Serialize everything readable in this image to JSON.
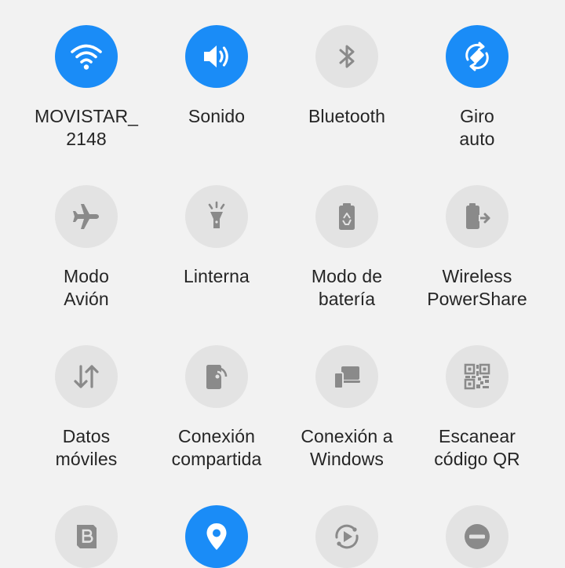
{
  "tiles": [
    {
      "label": "MOVISTAR_\n2148",
      "icon": "wifi-icon",
      "active": true
    },
    {
      "label": "Sonido",
      "icon": "sound-icon",
      "active": true
    },
    {
      "label": "Bluetooth",
      "icon": "bluetooth-icon",
      "active": false
    },
    {
      "label": "Giro\nauto",
      "icon": "auto-rotate-icon",
      "active": true
    },
    {
      "label": "Modo\nAvión",
      "icon": "airplane-icon",
      "active": false
    },
    {
      "label": "Linterna",
      "icon": "flashlight-icon",
      "active": false
    },
    {
      "label": "Modo de\nbatería",
      "icon": "battery-mode-icon",
      "active": false
    },
    {
      "label": "Wireless\nPowerShare",
      "icon": "wireless-powershare-icon",
      "active": false
    },
    {
      "label": "Datos\nmóviles",
      "icon": "mobile-data-icon",
      "active": false
    },
    {
      "label": "Conexión\ncompartida",
      "icon": "hotspot-icon",
      "active": false
    },
    {
      "label": "Conexión a\nWindows",
      "icon": "link-to-windows-icon",
      "active": false
    },
    {
      "label": "Escanear\ncódigo QR",
      "icon": "qr-code-icon",
      "active": false
    },
    {
      "label": "",
      "icon": "bixby-routines-icon",
      "active": false
    },
    {
      "label": "",
      "icon": "location-icon",
      "active": true
    },
    {
      "label": "",
      "icon": "sync-icon",
      "active": false
    },
    {
      "label": "",
      "icon": "do-not-disturb-icon",
      "active": false
    }
  ],
  "colors": {
    "active": "#1a8cf7",
    "inactive": "#e3e3e3",
    "icon_inactive": "#8a8a8a"
  }
}
